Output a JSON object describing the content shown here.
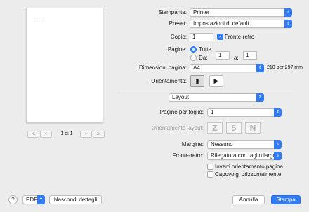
{
  "preview": {
    "page_indicator": "1 di 1",
    "first": "≪",
    "prev": "<",
    "next": ">",
    "last": "≫"
  },
  "printer": {
    "label": "Stampante:",
    "value": "Printer"
  },
  "preset": {
    "label": "Preset:",
    "value": "Impostazioni di default"
  },
  "copies": {
    "label": "Copie:",
    "value": "1",
    "duplex_label": "Fronte-retro",
    "duplex_checked": true
  },
  "pages": {
    "label": "Pagine:",
    "all_label": "Tutte",
    "from_label": "Da:",
    "from_value": "1",
    "to_label": "a:",
    "to_value": "1"
  },
  "paper_size": {
    "label": "Dimensioni pagina:",
    "value": "A4",
    "dimensions": "210 per 297 mm"
  },
  "orientation": {
    "label": "Orientamento:"
  },
  "section_menu": {
    "value": "Layout"
  },
  "pages_per_sheet": {
    "label": "Pagine per foglio:",
    "value": "1"
  },
  "layout_direction": {
    "label": "Orientamento layout:"
  },
  "border": {
    "label": "Margine:",
    "value": "Nessuno"
  },
  "two_sided": {
    "label": "Fronte-retro:",
    "value": "Rilegatura con taglio largo"
  },
  "options": {
    "reverse_orientation": "Inverti orientamento pagina",
    "flip_horizontal": "Capovolgi orizzontalmente"
  },
  "footer": {
    "help": "?",
    "pdf": "PDF",
    "hide_details": "Nascondi dettagli",
    "cancel": "Annulla",
    "print": "Stampa"
  },
  "colors": {
    "accent": "#2f7cf6",
    "background": "#ececec"
  },
  "icons": [
    "chevron-updown-icon",
    "portrait-icon",
    "landscape-icon",
    "layout-z-icon",
    "layout-s-icon",
    "layout-n-icon",
    "help-icon",
    "checkmark-icon"
  ]
}
